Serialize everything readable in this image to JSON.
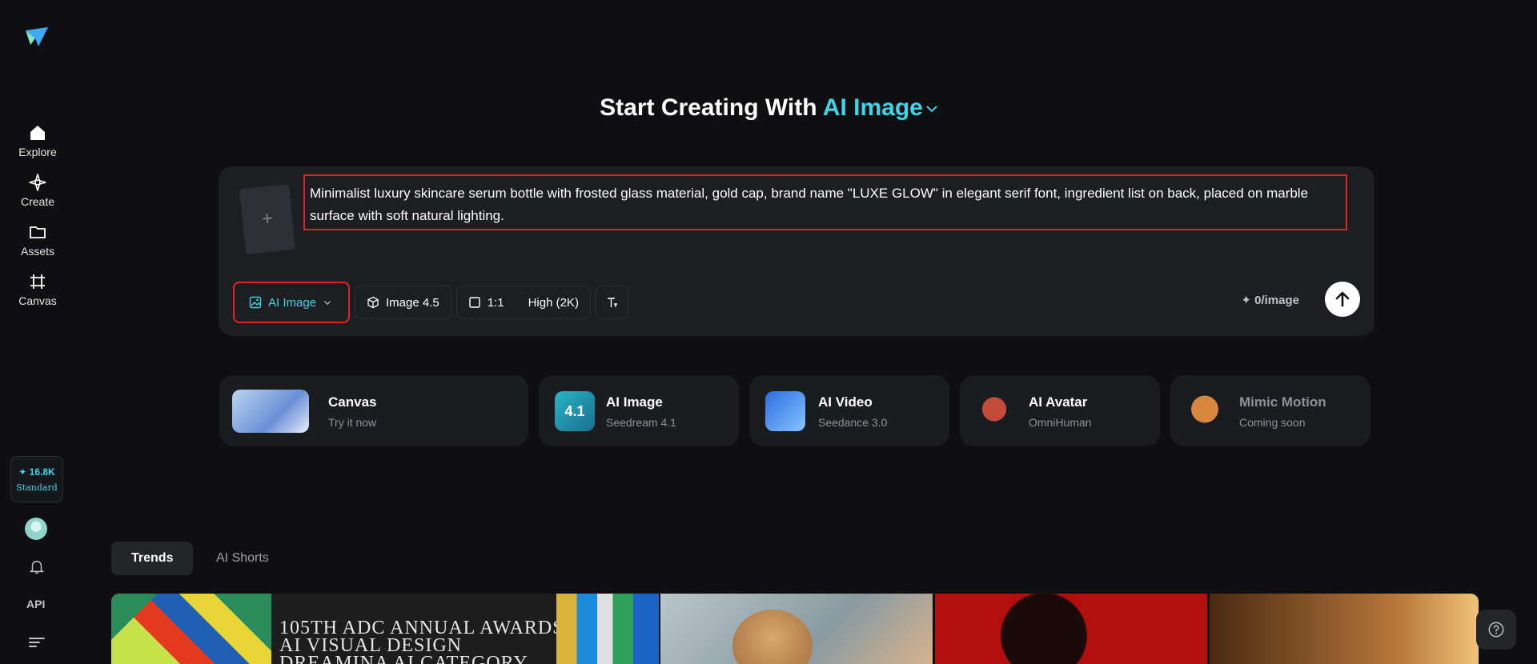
{
  "sidebar": {
    "nav": [
      {
        "label": "Explore",
        "icon": "home-icon"
      },
      {
        "label": "Create",
        "icon": "sparkle-icon"
      },
      {
        "label": "Assets",
        "icon": "folder-icon"
      },
      {
        "label": "Canvas",
        "icon": "crop-frame-icon"
      }
    ],
    "credits": {
      "amount": "16.8K",
      "plan": "Standard"
    },
    "api_label": "API"
  },
  "heading": {
    "prefix": "Start Creating With",
    "accent": "AI Image"
  },
  "prompt": {
    "text": "Minimalist luxury skincare serum bottle with frosted glass material, gold cap, brand name \"LUXE GLOW\" in elegant serif font, ingredient list on back, placed on marble surface with soft natural lighting.",
    "upload_symbol": "+"
  },
  "toolbar": {
    "mode_label": "AI Image",
    "model_label": "Image 4.5",
    "ratio_label": "1:1",
    "quality_label": "High (2K)",
    "cost_label": "0/image"
  },
  "features": [
    {
      "title": "Canvas",
      "subtitle": "Try it now"
    },
    {
      "title": "AI Image",
      "subtitle": "Seedream 4.1",
      "badge": "4.1"
    },
    {
      "title": "AI Video",
      "subtitle": "Seedance 3.0"
    },
    {
      "title": "AI Avatar",
      "subtitle": "OmniHuman"
    },
    {
      "title": "Mimic Motion",
      "subtitle": "Coming soon"
    }
  ],
  "tabs": [
    {
      "label": "Trends"
    },
    {
      "label": "AI Shorts"
    }
  ],
  "gallery": {
    "tile1_text": [
      "105TH ADC ANNUAL AWARDS",
      "AI VISUAL DESIGN",
      "DREAMINA AI CATEGORY"
    ]
  },
  "colors": {
    "accent": "#3fd4e8",
    "background": "#0f0f11",
    "highlight_border": "#e02424"
  }
}
